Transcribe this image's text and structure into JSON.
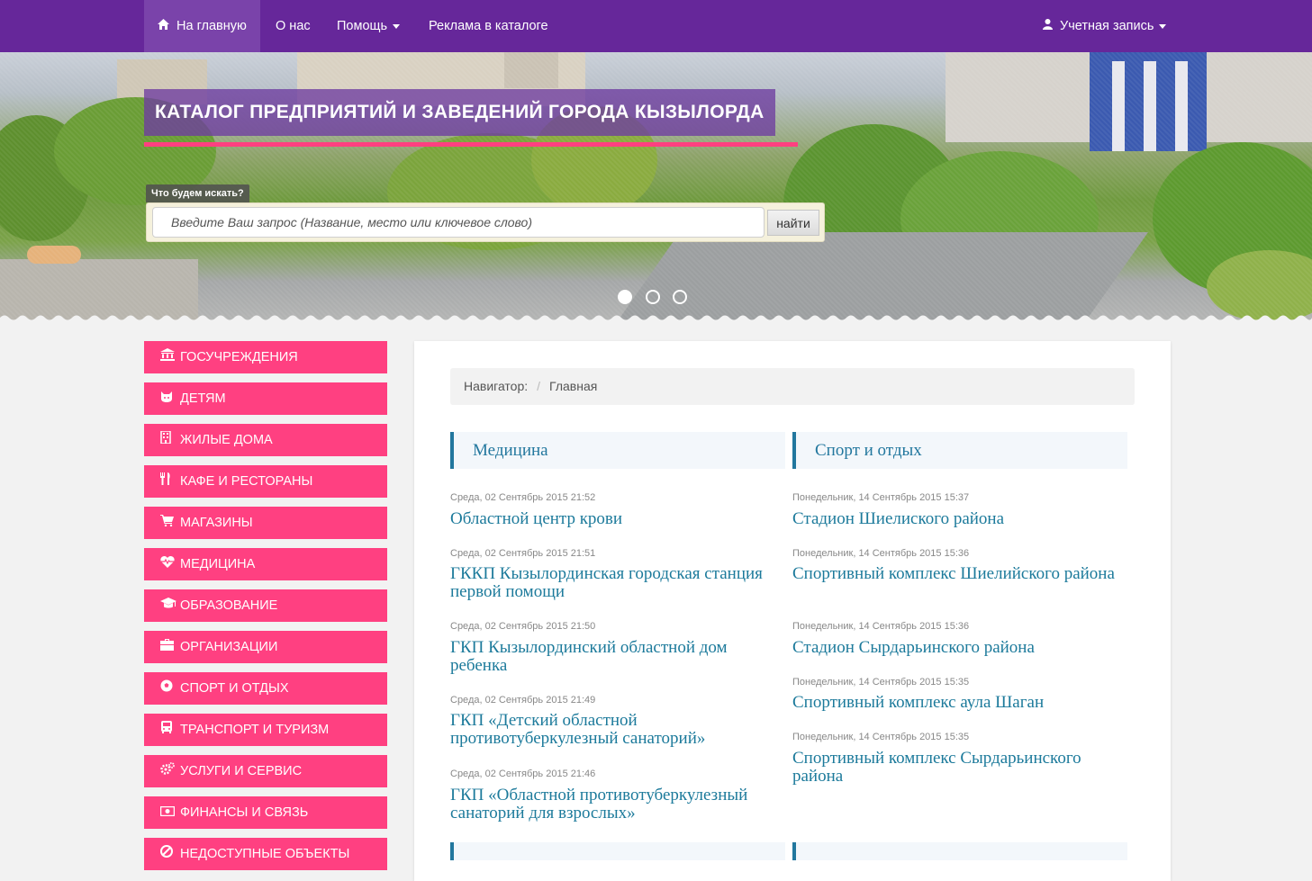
{
  "navbar": {
    "items": [
      {
        "label": "На главную",
        "icon": "home-icon",
        "active": true
      },
      {
        "label": "О нас"
      },
      {
        "label": "Помощь",
        "dropdown": true
      },
      {
        "label": "Реклама в каталоге"
      }
    ],
    "account": {
      "label": "Учетная запись",
      "icon": "user-icon"
    }
  },
  "hero": {
    "title": "КАТАЛОГ ПРЕДПРИЯТИЙ И ЗАВЕДЕНИЙ ГОРОДА КЫЗЫЛОРДА",
    "search_label": "Что будем искать?",
    "search_placeholder": "Введите Ваш запрос (Название, место или ключевое слово)",
    "search_button": "найти",
    "slides_count": 3,
    "active_slide": 1
  },
  "sidebar": {
    "items": [
      {
        "label": "ГОСУЧРЕЖДЕНИЯ",
        "icon": "bank-icon"
      },
      {
        "label": "ДЕТЯМ",
        "icon": "child-icon"
      },
      {
        "label": "ЖИЛЫЕ ДОМА",
        "icon": "building-icon"
      },
      {
        "label": "КАФЕ И РЕСТОРАНЫ",
        "icon": "cutlery-icon"
      },
      {
        "label": "МАГАЗИНЫ",
        "icon": "cart-icon"
      },
      {
        "label": "МЕДИЦИНА",
        "icon": "heartbeat-icon"
      },
      {
        "label": "ОБРАЗОВАНИЕ",
        "icon": "graduation-cap-icon"
      },
      {
        "label": "ОРГАНИЗАЦИИ",
        "icon": "briefcase-icon"
      },
      {
        "label": "СПОРТ И ОТДЫХ",
        "icon": "soccer-ball-icon"
      },
      {
        "label": "ТРАНСПОРТ И ТУРИЗМ",
        "icon": "bus-icon"
      },
      {
        "label": "УСЛУГИ И СЕРВИС",
        "icon": "gears-icon"
      },
      {
        "label": "ФИНАНСЫ И СВЯЗЬ",
        "icon": "money-icon"
      },
      {
        "label": "НЕДОСТУПНЫЕ ОБЪЕКТЫ",
        "icon": "ban-icon"
      }
    ]
  },
  "breadcrumb": {
    "prefix": "Навигатор:",
    "separator": "/",
    "current": "Главная"
  },
  "columns": [
    {
      "heading": "Медицина",
      "articles": [
        {
          "date": "Среда, 02 Сентябрь 2015 21:52",
          "title": "Областной центр крови"
        },
        {
          "date": "Среда, 02 Сентябрь 2015 21:51",
          "title": "ГККП Кызылординская городская станция первой помощи"
        },
        {
          "date": "Среда, 02 Сентябрь 2015 21:50",
          "title": "ГКП Кызылординский областной дом ребенка"
        },
        {
          "date": "Среда, 02 Сентябрь 2015 21:49",
          "title": "ГКП «Детский областной противотуберкулезный санаторий»"
        },
        {
          "date": "Среда, 02 Сентябрь 2015 21:46",
          "title": "ГКП «Областной противотуберкулезный санаторий для взрослых»"
        }
      ]
    },
    {
      "heading": "Спорт и отдых",
      "articles": [
        {
          "date": "Понедельник, 14 Сентябрь 2015 15:37",
          "title": "Стадион Шиелиского района"
        },
        {
          "date": "Понедельник, 14 Сентябрь 2015 15:36",
          "title": "Спортивный комплекс Шиелийского района"
        },
        {
          "date": "Понедельник, 14 Сентябрь 2015 15:36",
          "title": "Стадион Сырдарьинского района"
        },
        {
          "date": "Понедельник, 14 Сентябрь 2015 15:35",
          "title": "Спортивный комплекс аула Шаган"
        },
        {
          "date": "Понедельник, 14 Сентябрь 2015 15:35",
          "title": "Спортивный комплекс Сырдарьинского района"
        }
      ]
    }
  ],
  "colors": {
    "navbar": "#66279a",
    "accent_pink": "#ff4081",
    "link_teal": "#1c7a9b"
  }
}
